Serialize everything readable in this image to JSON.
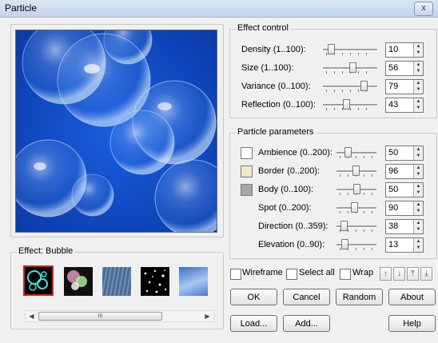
{
  "window": {
    "title": "Particle",
    "close_glyph": "x"
  },
  "effect_control": {
    "legend": "Effect control",
    "rows": [
      {
        "label": "Density (1..100):",
        "value": "10",
        "level": 0.1
      },
      {
        "label": "Size (1..100):",
        "value": "56",
        "level": 0.56
      },
      {
        "label": "Variance (0..100):",
        "value": "79",
        "level": 0.79
      },
      {
        "label": "Reflection (0..100):",
        "value": "43",
        "level": 0.43
      }
    ]
  },
  "particle_parameters": {
    "legend": "Particle parameters",
    "rows": [
      {
        "label": "Ambience (0..200):",
        "value": "50",
        "level": 0.25,
        "swatch": "#ffffff"
      },
      {
        "label": "Border (0..200):",
        "value": "96",
        "level": 0.48,
        "swatch": "#eeeac8"
      },
      {
        "label": "Body (0..100):",
        "value": "50",
        "level": 0.5,
        "swatch": "#a7a7a7"
      },
      {
        "label": "Spot (0..200):",
        "value": "90",
        "level": 0.45
      },
      {
        "label": "Direction (0..359):",
        "value": "38",
        "level": 0.11
      },
      {
        "label": "Elevation (0..90):",
        "value": "13",
        "level": 0.14
      }
    ]
  },
  "effect_group": {
    "legend": "Effect: Bubble",
    "scroll_grip": "III"
  },
  "options": {
    "wireframe": "Wireframe",
    "select_all": "Select all",
    "wrap": "Wrap"
  },
  "buttons": {
    "ok": "OK",
    "cancel": "Cancel",
    "random": "Random",
    "about": "About",
    "load": "Load...",
    "add": "Add...",
    "help": "Help"
  },
  "colors": {
    "preview_bg": "#0a45c6",
    "selected_border": "#d42020"
  }
}
